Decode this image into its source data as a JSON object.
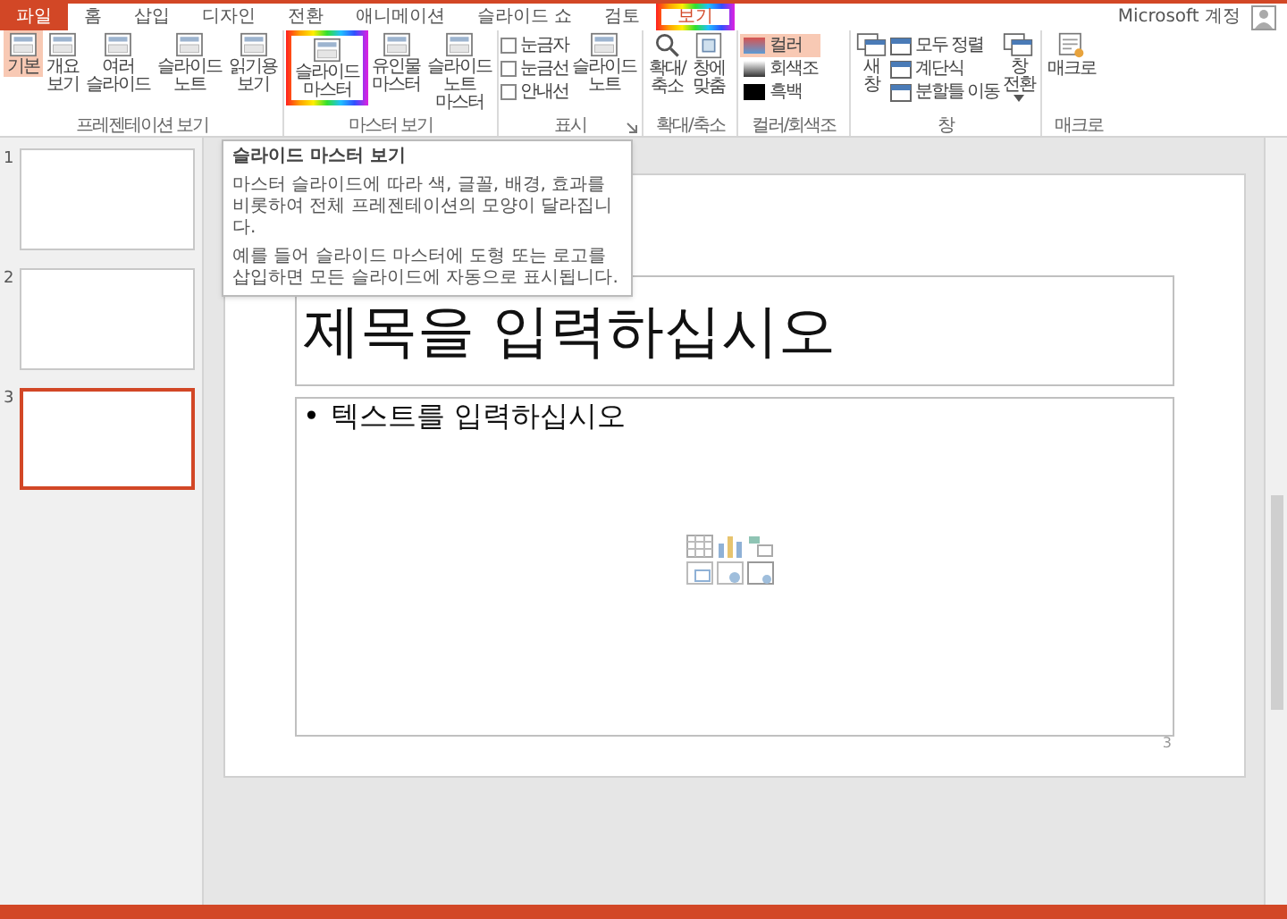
{
  "tabs": [
    {
      "label": "파일",
      "kind": "file"
    },
    {
      "label": "홈",
      "kind": "tab",
      "selected": false
    },
    {
      "label": "삽입",
      "kind": "tab",
      "selected": false
    },
    {
      "label": "디자인",
      "kind": "tab",
      "selected": false
    },
    {
      "label": "전환",
      "kind": "tab",
      "selected": false
    },
    {
      "label": "애니메이션",
      "kind": "tab",
      "selected": false
    },
    {
      "label": "슬라이드 쇼",
      "kind": "tab",
      "selected": false
    },
    {
      "label": "검토",
      "kind": "tab",
      "selected": false
    },
    {
      "label": "보기",
      "kind": "tab",
      "selected": true,
      "highlighted": true
    }
  ],
  "account": {
    "label": "Microsoft 계정"
  },
  "ribbon": {
    "groups": [
      {
        "label": "프레젠테이션 보기",
        "items": [
          {
            "kind": "large",
            "label": "기본",
            "selected": true
          },
          {
            "kind": "large",
            "label": "개요 보기",
            "selected": false
          },
          {
            "kind": "large",
            "label": "여러 슬라이드",
            "selected": false
          },
          {
            "kind": "large",
            "label": "슬라이드 노트",
            "selected": false
          },
          {
            "kind": "large",
            "label": "읽기용 보기",
            "selected": false
          }
        ]
      },
      {
        "label": "마스터 보기",
        "items": [
          {
            "kind": "large",
            "label": "슬라이드 마스터",
            "highlighted": true
          },
          {
            "kind": "large",
            "label": "유인물 마스터"
          },
          {
            "kind": "large",
            "label": "슬라이드 노트 마스터"
          }
        ]
      },
      {
        "label": "표시",
        "launcher": true,
        "items": [
          {
            "kind": "checkbox",
            "label": "눈금자",
            "checked": false
          },
          {
            "kind": "checkbox",
            "label": "눈금선",
            "checked": false
          },
          {
            "kind": "checkbox",
            "label": "안내선",
            "checked": false
          },
          {
            "kind": "large",
            "label": "슬라이드 노트"
          }
        ]
      },
      {
        "label": "확대/축소",
        "items": [
          {
            "kind": "large",
            "label": "확대/ 축소"
          },
          {
            "kind": "large",
            "label": "창에 맞춤"
          }
        ]
      },
      {
        "label": "컬러/회색조",
        "items": [
          {
            "kind": "color",
            "label": "컬러",
            "selected": true
          },
          {
            "kind": "color",
            "label": "회색조",
            "selected": false
          },
          {
            "kind": "color",
            "label": "흑백",
            "selected": false
          }
        ]
      },
      {
        "label": "창",
        "items": [
          {
            "kind": "large",
            "label": "새 창"
          },
          {
            "kind": "small",
            "label": "모두 정렬"
          },
          {
            "kind": "small",
            "label": "계단식"
          },
          {
            "kind": "small",
            "label": "분할틀 이동"
          },
          {
            "kind": "large",
            "label": "창 전환",
            "dropdown": true
          }
        ]
      },
      {
        "label": "매크로",
        "items": [
          {
            "kind": "large",
            "label": "매크로"
          }
        ]
      }
    ]
  },
  "tooltip": {
    "title": "슬라이드 마스터 보기",
    "paragraphs": [
      "마스터 슬라이드에 따라 색, 글꼴, 배경, 효과를 비롯하여 전체 프레젠테이션의 모양이 달라집니다.",
      "예를 들어 슬라이드 마스터에 도형 또는 로고를 삽입하면 모든 슬라이드에 자동으로 표시됩니다."
    ]
  },
  "thumbnails": [
    {
      "number": "1",
      "selected": false
    },
    {
      "number": "2",
      "selected": false
    },
    {
      "number": "3",
      "selected": true
    }
  ],
  "slide": {
    "title_placeholder": "제목을 입력하십시오",
    "bullet": "•",
    "body_placeholder": "텍스트를 입력하십시오",
    "number": "3"
  }
}
